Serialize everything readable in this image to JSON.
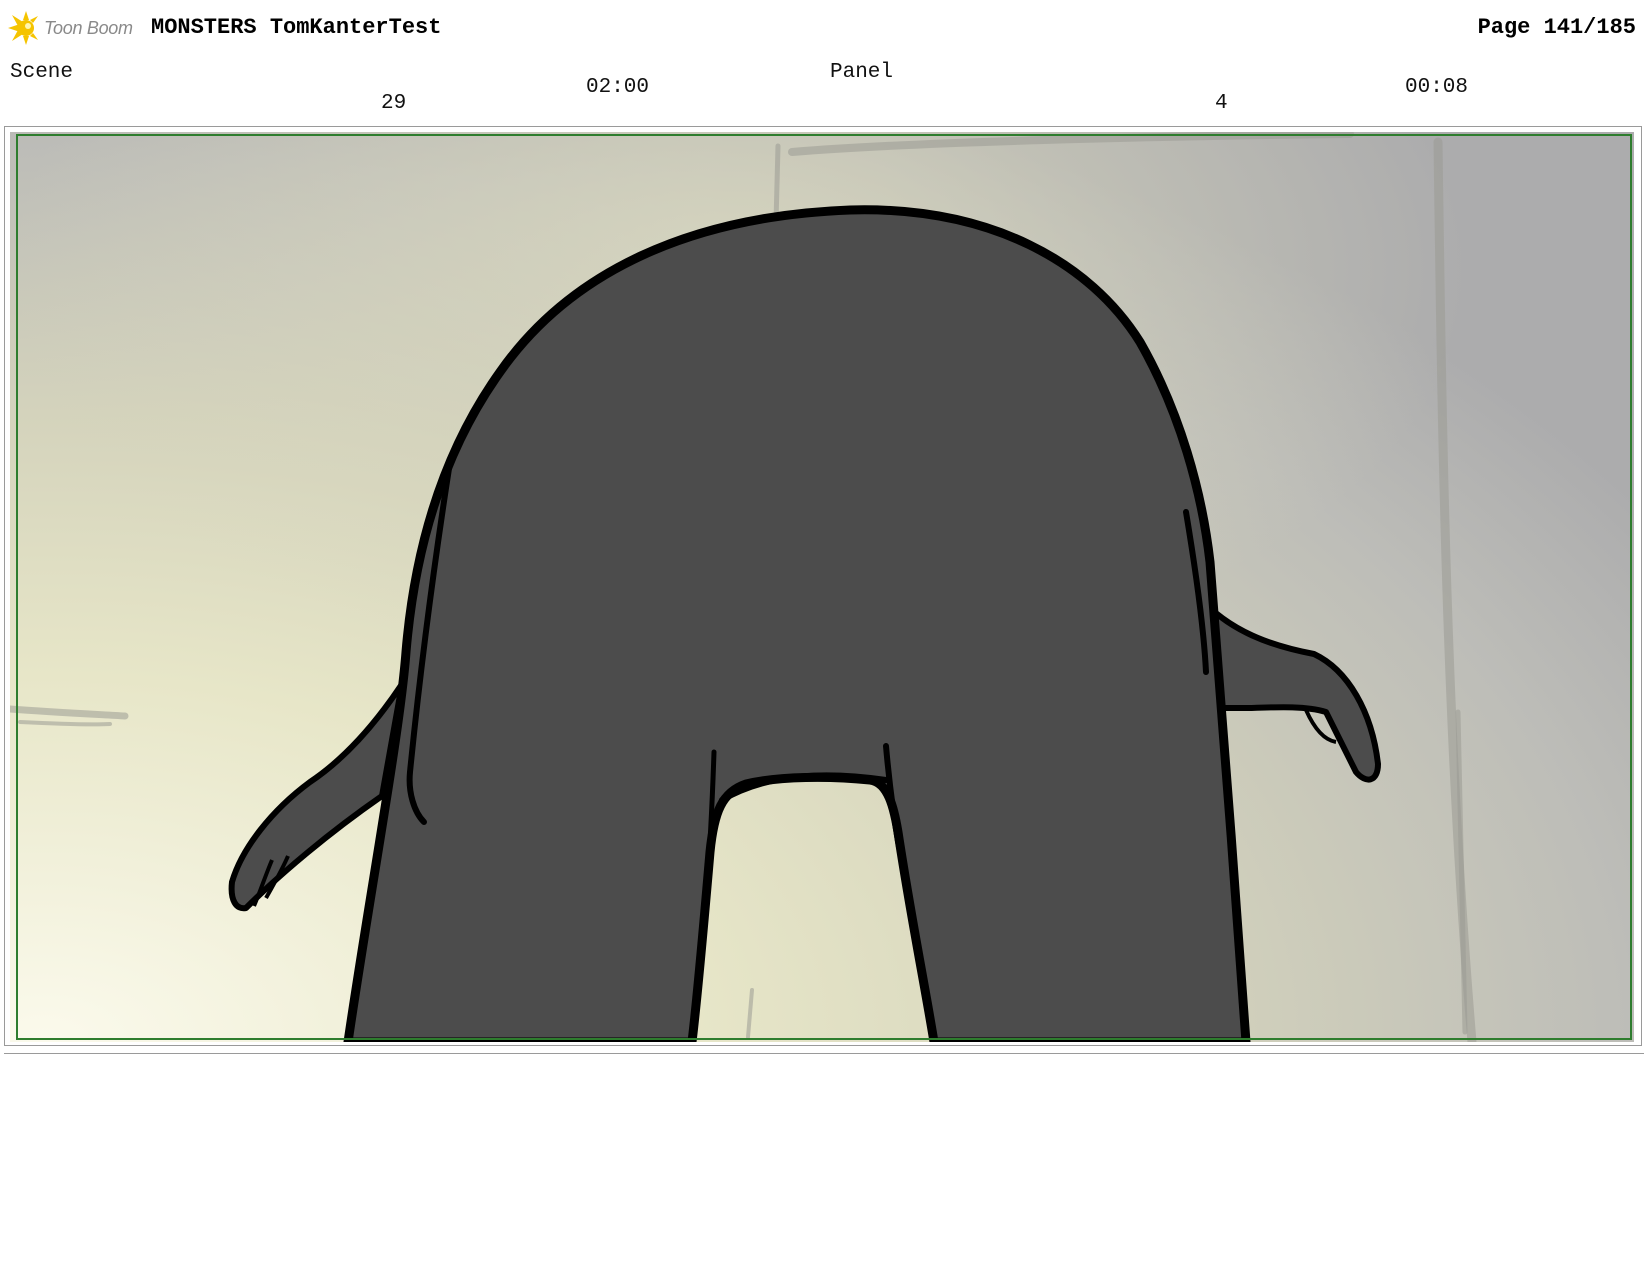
{
  "header": {
    "logo": {
      "icon": "toon-boom-sun-icon",
      "text": "Toon Boom",
      "accent_color": "#f5c400"
    },
    "title": "MONSTERS TomKanterTest",
    "page": "Page 141/185"
  },
  "scene": {
    "label": "Scene",
    "number": "29",
    "duration": "02:00"
  },
  "panel": {
    "label": "Panel",
    "number": "4",
    "duration": "00:08"
  },
  "artwork": {
    "description_icon": "monster-silhouette-drawing",
    "body_color": "#4c4c4c",
    "outline_color": "#000000",
    "safe_frame_color": "#2e7d2e",
    "background_light": "#f9f8e6",
    "background_dark": "#ababab"
  }
}
